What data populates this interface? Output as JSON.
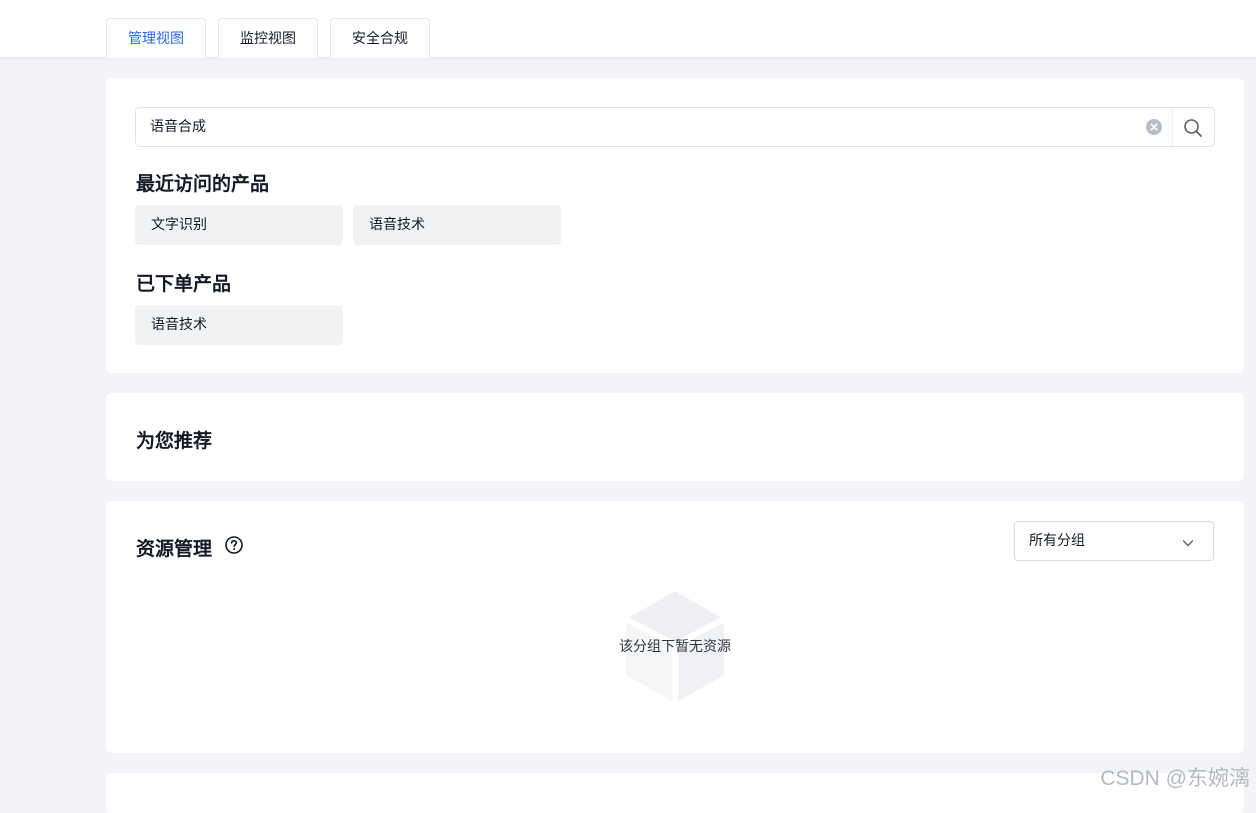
{
  "tabs": [
    {
      "label": "管理视图",
      "active": true
    },
    {
      "label": "监控视图",
      "active": false
    },
    {
      "label": "安全合规",
      "active": false
    }
  ],
  "search": {
    "value": "语音合成",
    "icons": {
      "clear": "close-circle-icon",
      "search": "search-icon"
    }
  },
  "recent": {
    "title": "最近访问的产品",
    "items": [
      "文字识别",
      "语音技术"
    ]
  },
  "ordered": {
    "title": "已下单产品",
    "items": [
      "语音技术"
    ]
  },
  "recommend": {
    "title": "为您推荐"
  },
  "resources": {
    "title": "资源管理",
    "help_icon": "question-circle-icon",
    "group_select": {
      "value": "所有分组",
      "icon": "chevron-down-icon"
    },
    "empty_text": "该分组下暂无资源"
  },
  "watermark": "CSDN @东婉漓",
  "colors": {
    "accent": "#2468f2",
    "background": "#f3f4f7",
    "chip_bg": "#f1f2f4",
    "text": "#151b26"
  }
}
